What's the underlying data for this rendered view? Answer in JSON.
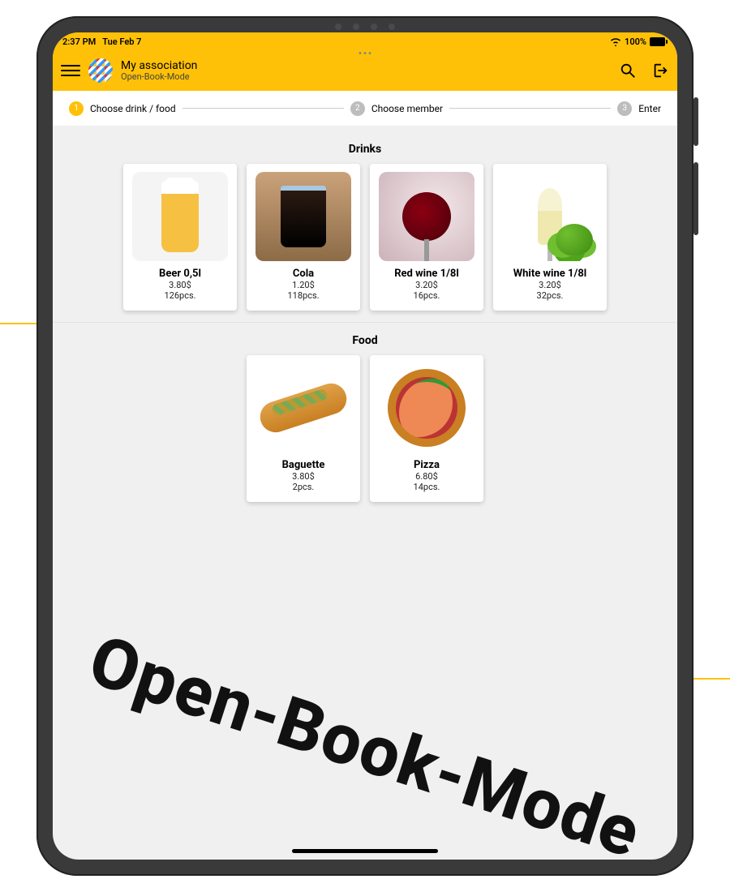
{
  "status_bar": {
    "time": "2:37 PM",
    "date": "Tue Feb 7",
    "battery": "100%"
  },
  "app_bar": {
    "title": "My association",
    "subtitle": "Open-Book-Mode"
  },
  "stepper": {
    "steps": [
      {
        "num": "1",
        "label": "Choose drink / food",
        "active": true
      },
      {
        "num": "2",
        "label": "Choose member",
        "active": false
      },
      {
        "num": "3",
        "label": "Enter",
        "active": false
      }
    ]
  },
  "sections": [
    {
      "title": "Drinks",
      "items": [
        {
          "name": "Beer 0,5l",
          "price": "3.80$",
          "stock": "126pcs.",
          "art": "beer"
        },
        {
          "name": "Cola",
          "price": "1.20$",
          "stock": "118pcs.",
          "art": "cola"
        },
        {
          "name": "Red wine 1/8l",
          "price": "3.20$",
          "stock": "16pcs.",
          "art": "redwine"
        },
        {
          "name": "White wine 1/8l",
          "price": "3.20$",
          "stock": "32pcs.",
          "art": "whitewine"
        }
      ]
    },
    {
      "title": "Food",
      "items": [
        {
          "name": "Baguette",
          "price": "3.80$",
          "stock": "2pcs.",
          "art": "baguette"
        },
        {
          "name": "Pizza",
          "price": "6.80$",
          "stock": "14pcs.",
          "art": "pizza"
        }
      ]
    }
  ],
  "watermark": "Open-Book-Mode"
}
